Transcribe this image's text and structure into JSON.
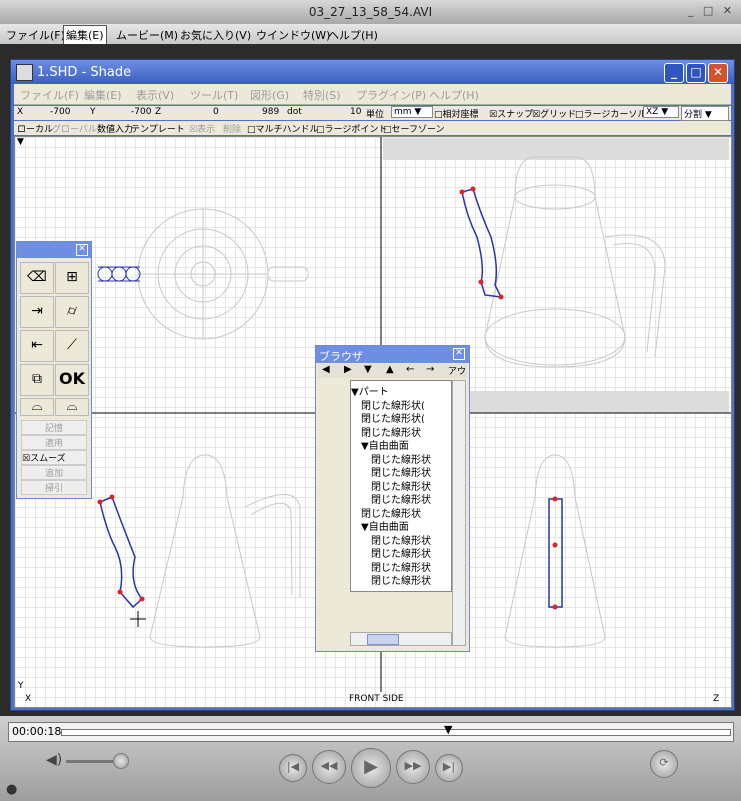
{
  "player": {
    "title": "03_27_13_58_54.AVI",
    "menu": [
      "ファイル(F)",
      "編集(E)",
      "ムービー(M)",
      "お気に入り(V)",
      "ウインドウ(W)",
      "ヘルプ(H)"
    ],
    "time": "00:00:18"
  },
  "shade": {
    "title": "1.SHD - Shade",
    "menu": [
      "ファイル(F)",
      "編集(E)",
      "表示(V)",
      "ツール(T)",
      "図形(G)",
      "特別(S)",
      "プラグイン(P)",
      "ヘルプ(H)"
    ],
    "status": {
      "x_label": "X",
      "x_val": "-700",
      "y_label": "Y",
      "y_val": "-700",
      "z_label": "Z",
      "z_val": "0",
      "dot_val": "989",
      "dot_unit": "dot",
      "unit_num": "10",
      "unit_label": "単位",
      "unit_sel": "mm",
      "relative": "□相対座標",
      "snap": "☒スナップ",
      "grid": "☒グリッド",
      "cursor": "□ラージカーソル",
      "plane": "XZ",
      "split": "分割"
    },
    "tools": {
      "local": "ローカル",
      "global": "グローバル",
      "numeric": "数値入力",
      "template": "テンプレート",
      "display": "☒表示",
      "delete": "削除",
      "multi": "□マルチハンドル",
      "large_point": "□ラージポイント",
      "safe": "□セーフゾーン"
    },
    "view_labels": {
      "x": "X",
      "y": "Y",
      "z": "Z",
      "bottom": "FRONT SIDE"
    }
  },
  "toolbox": {
    "ok": "OK",
    "buttons": [
      "記憶",
      "適用"
    ],
    "smooth": "☒スムーズ",
    "buttons2": [
      "追加",
      "掃引"
    ]
  },
  "browser": {
    "title": "ブラウザ",
    "tab": "アウ",
    "rows": [
      {
        "indent": 0,
        "text": "▼パート"
      },
      {
        "indent": 1,
        "text": "閉じた線形状("
      },
      {
        "indent": 1,
        "text": "閉じた線形状("
      },
      {
        "indent": 1,
        "text": "閉じた線形状"
      },
      {
        "indent": 1,
        "text": "▼自由曲面"
      },
      {
        "indent": 2,
        "text": "閉じた線形状"
      },
      {
        "indent": 2,
        "text": "閉じた線形状"
      },
      {
        "indent": 2,
        "text": "閉じた線形状"
      },
      {
        "indent": 2,
        "text": "閉じた線形状"
      },
      {
        "indent": 1,
        "text": "閉じた線形状"
      },
      {
        "indent": 1,
        "text": "▼自由曲面"
      },
      {
        "indent": 2,
        "text": "閉じた線形状"
      },
      {
        "indent": 2,
        "text": "閉じた線形状"
      },
      {
        "indent": 2,
        "text": "閉じた線形状"
      },
      {
        "indent": 2,
        "text": "閉じた線形状"
      }
    ]
  },
  "colors": {
    "titlebar": "#4f72c8",
    "curve": "#2633b8",
    "point": "#e0202a"
  }
}
